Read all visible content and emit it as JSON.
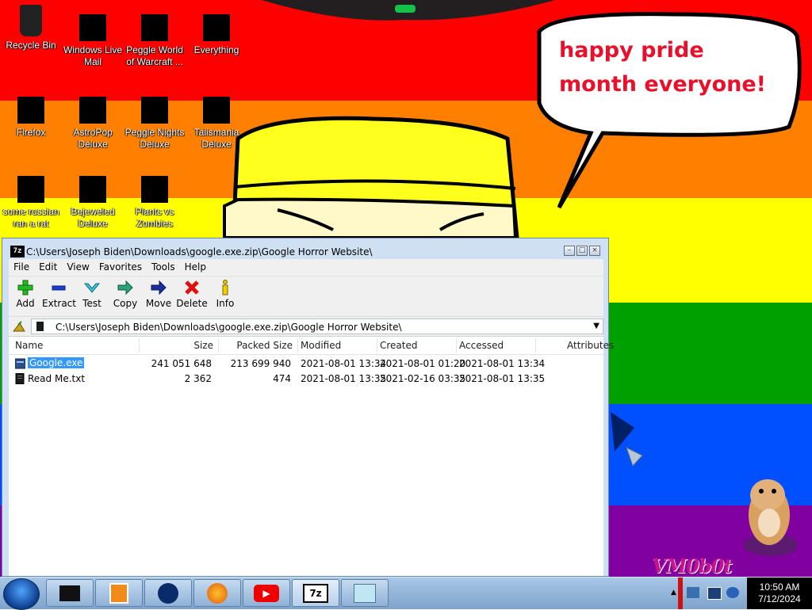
{
  "desktop": {
    "icons": [
      {
        "label": "Recycle Bin"
      },
      {
        "label": "Windows Live Mail"
      },
      {
        "label": "Peggle World of Warcraft ..."
      },
      {
        "label": "Everything"
      },
      {
        "label": "Firefox"
      },
      {
        "label": "AstroPop Deluxe"
      },
      {
        "label": "Peggle Nights Deluxe"
      },
      {
        "label": "Talismania Deluxe"
      },
      {
        "label": "some russian ran a rat"
      },
      {
        "label": "Bejeweled Deluxe"
      },
      {
        "label": "Plants vs Zombies"
      }
    ],
    "bubble_text": "happy pride month everyone!",
    "watermark": "VM0b0t",
    "stripe_colors": [
      "#ff0000",
      "#ff8000",
      "#ffff00",
      "#00a000",
      "#0050ff",
      "#8000a0"
    ]
  },
  "window": {
    "title": "C:\\Users\\Joseph Biden\\Downloads\\google.exe.zip\\Google Horror Website\\",
    "app_icon": "7z",
    "menu": [
      "File",
      "Edit",
      "View",
      "Favorites",
      "Tools",
      "Help"
    ],
    "toolbar": [
      {
        "label": "Add",
        "icon": "plus-icon"
      },
      {
        "label": "Extract",
        "icon": "minus-icon"
      },
      {
        "label": "Test",
        "icon": "check-icon"
      },
      {
        "label": "Copy",
        "icon": "arrow-right-double-icon"
      },
      {
        "label": "Move",
        "icon": "arrow-right-icon"
      },
      {
        "label": "Delete",
        "icon": "x-icon"
      },
      {
        "label": "Info",
        "icon": "info-icon"
      }
    ],
    "address": "C:\\Users\\Joseph Biden\\Downloads\\google.exe.zip\\Google Horror Website\\",
    "columns": [
      "Name",
      "Size",
      "Packed Size",
      "Modified",
      "Created",
      "Accessed",
      "Attributes"
    ],
    "files": [
      {
        "name": "Google.exe",
        "size": "241 051 648",
        "packed": "213 699 940",
        "modified": "2021-08-01 13:34",
        "created": "2021-08-01 01:20",
        "accessed": "2021-08-01 13:34",
        "selected": true
      },
      {
        "name": "Read Me.txt",
        "size": "2 362",
        "packed": "474",
        "modified": "2021-08-01 13:35",
        "created": "2021-02-16 03:35",
        "accessed": "2021-08-01 13:35",
        "selected": false
      }
    ]
  },
  "taskbar": {
    "clock_time": "10:50 AM",
    "clock_date": "7/12/2024"
  }
}
